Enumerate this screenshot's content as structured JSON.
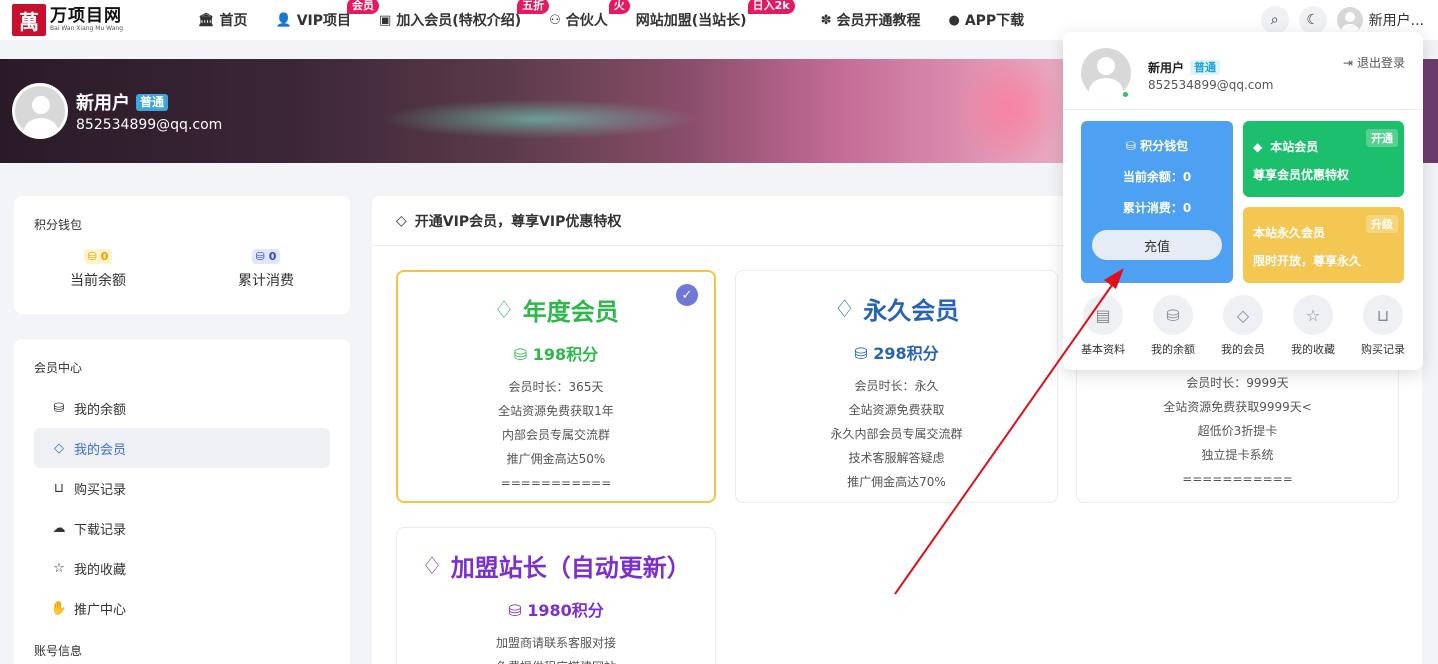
{
  "site": {
    "logo_mark": "萬",
    "logo_title": "万项目网",
    "logo_sub": "Bai Wan Xiang Mu Wang"
  },
  "nav": [
    {
      "label": "首页",
      "icon": "bank-icon"
    },
    {
      "label": "VIP项目",
      "icon": "user-icon",
      "badge": "会员"
    },
    {
      "label": "加入会员(特权介绍)",
      "icon": "vimeo-icon",
      "badge": "五折"
    },
    {
      "label": "合伙人",
      "icon": "binoculars-icon",
      "badge": "火"
    },
    {
      "label": "网站加盟(当站长)",
      "icon": "",
      "badge": "日入2k"
    },
    {
      "label": "会员开通教程",
      "icon": "leaf-icon"
    },
    {
      "label": "APP下载",
      "icon": "apple-icon"
    }
  ],
  "header": {
    "username_short": "新用户..."
  },
  "user": {
    "name": "新用户",
    "level": "普通",
    "email": "852534899@qq.com"
  },
  "wallet": {
    "title": "积分钱包",
    "balance": "0",
    "balance_label": "当前余额",
    "spent": "0",
    "spent_label": "累计消费"
  },
  "member_center": {
    "title": "会员中心",
    "items": [
      {
        "label": "我的余额",
        "icon": "coins-icon"
      },
      {
        "label": "我的会员",
        "icon": "diamond-icon"
      },
      {
        "label": "购买记录",
        "icon": "basket-icon"
      },
      {
        "label": "下载记录",
        "icon": "cloud-download-icon"
      },
      {
        "label": "我的收藏",
        "icon": "star-icon"
      },
      {
        "label": "推广中心",
        "icon": "hand-coin-icon"
      }
    ],
    "account_title": "账号信息"
  },
  "main": {
    "title": "开通VIP会员，尊享VIP优惠特权",
    "plans": [
      {
        "title": "年度会员",
        "price": "198积分",
        "color": "#2db84a",
        "features": [
          "会员时长：365天",
          "全站资源免费获取1年",
          "内部会员专属交流群",
          "推广佣金高达50%",
          "==========="
        ]
      },
      {
        "title": "永久会员",
        "price": "298积分",
        "color": "#2762b5",
        "features": [
          "会员时长：永久",
          "全站资源免费获取",
          "永久内部会员专属交流群",
          "技术客服解答疑虑",
          "推广佣金高达70%"
        ]
      },
      {
        "features": [
          "会员时长：9999天",
          "全站资源免费获取9999天<",
          "超低价3折提卡",
          "独立提卡系统",
          "==========="
        ]
      },
      {
        "title": "加盟站长（自动更新）",
        "price": "1980积分",
        "color": "#7b2fd0",
        "features": [
          "加盟商请联系客服对接",
          "免费提供程序搭建网站"
        ]
      }
    ]
  },
  "dropdown": {
    "name": "新用户",
    "level": "普通",
    "email": "852534899@qq.com",
    "logout": "退出登录",
    "wallet_title": "积分钱包",
    "balance_line": "当前余额：0",
    "spent_line": "累计消费：0",
    "recharge": "充值",
    "vip_title": "本站会员",
    "vip_desc": "尊享会员优惠特权",
    "vip_tag": "开通",
    "perm_title": "本站永久会员",
    "perm_desc": "限时开放，尊享永久",
    "perm_tag": "升级",
    "links": [
      "基本资料",
      "我的余额",
      "我的会员",
      "我的收藏",
      "购买记录"
    ]
  },
  "colors": {
    "accent_blue": "#4da0f2",
    "accent_green": "#1cc06c",
    "accent_yellow": "#f4c752",
    "badge_pink": "#e5195f",
    "annotation_red": "#e0101a"
  }
}
